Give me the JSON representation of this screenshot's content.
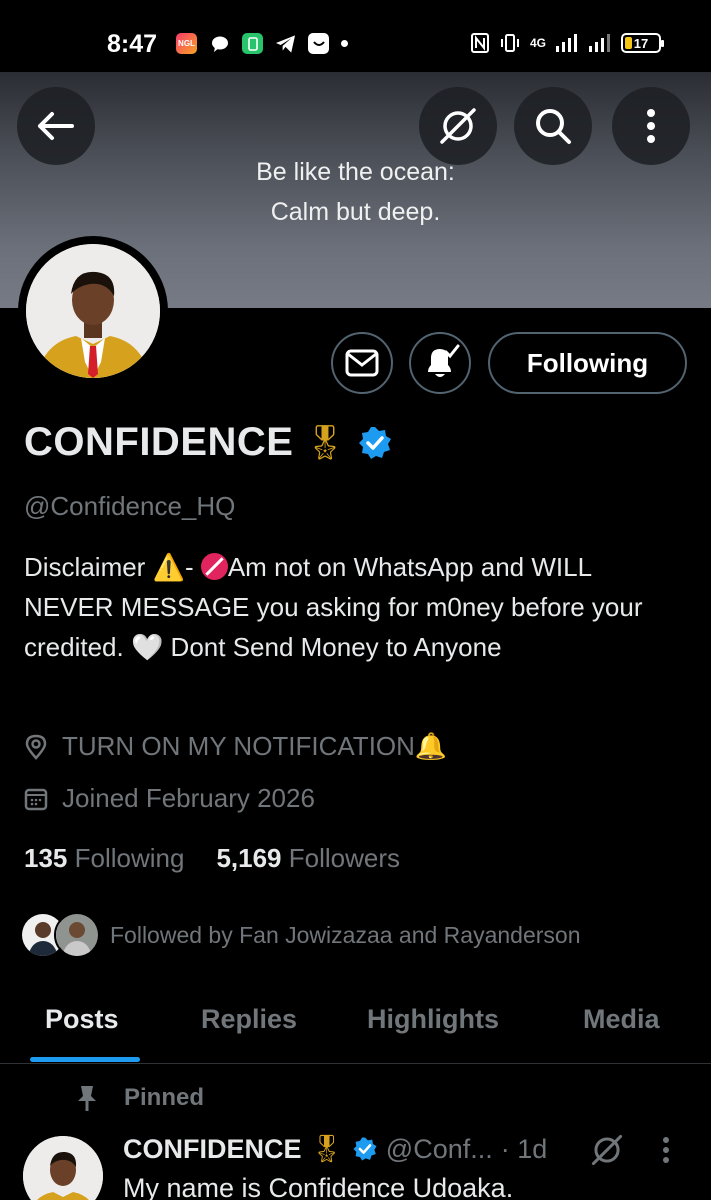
{
  "status_bar": {
    "time": "8:47",
    "ngl_label": "NGL",
    "network": "4G",
    "battery": "17"
  },
  "banner": {
    "line1": "Be like the ocean:",
    "line2": "Calm but deep."
  },
  "actions": {
    "follow_label": "Following"
  },
  "profile": {
    "name": "CONFIDENCE",
    "name_emoji": "🎖",
    "handle": "@Confidence_HQ",
    "bio_part1": "Disclaimer ",
    "bio_warn": "⚠️",
    "bio_part2": "- ",
    "bio_part3": "Am not on WhatsApp and WILL NEVER MESSAGE you asking for m0ney before your credited. ",
    "bio_heart": "🤍",
    "bio_part4": " Dont Send Money to Anyone",
    "location": "TURN ON MY NOTIFICATION",
    "location_emoji": "🔔",
    "joined": "Joined February 2026",
    "following_count": "135",
    "following_label": "Following",
    "followers_count": "5,169",
    "followers_label": "Followers",
    "followed_by": "Followed by Fan Jowizazaa and Rayanderson"
  },
  "tabs": [
    {
      "label": "Posts"
    },
    {
      "label": "Replies"
    },
    {
      "label": "Highlights"
    },
    {
      "label": "Media"
    }
  ],
  "pinned_post": {
    "pinned_label": "Pinned",
    "author": "CONFIDENCE",
    "author_emoji": "🎖",
    "handle": "@Conf...",
    "time": "· 1d",
    "text": "My name is Confidence Udoaka."
  },
  "colors": {
    "accent": "#1d9bf0",
    "muted": "#71767b",
    "border": "#536471"
  }
}
